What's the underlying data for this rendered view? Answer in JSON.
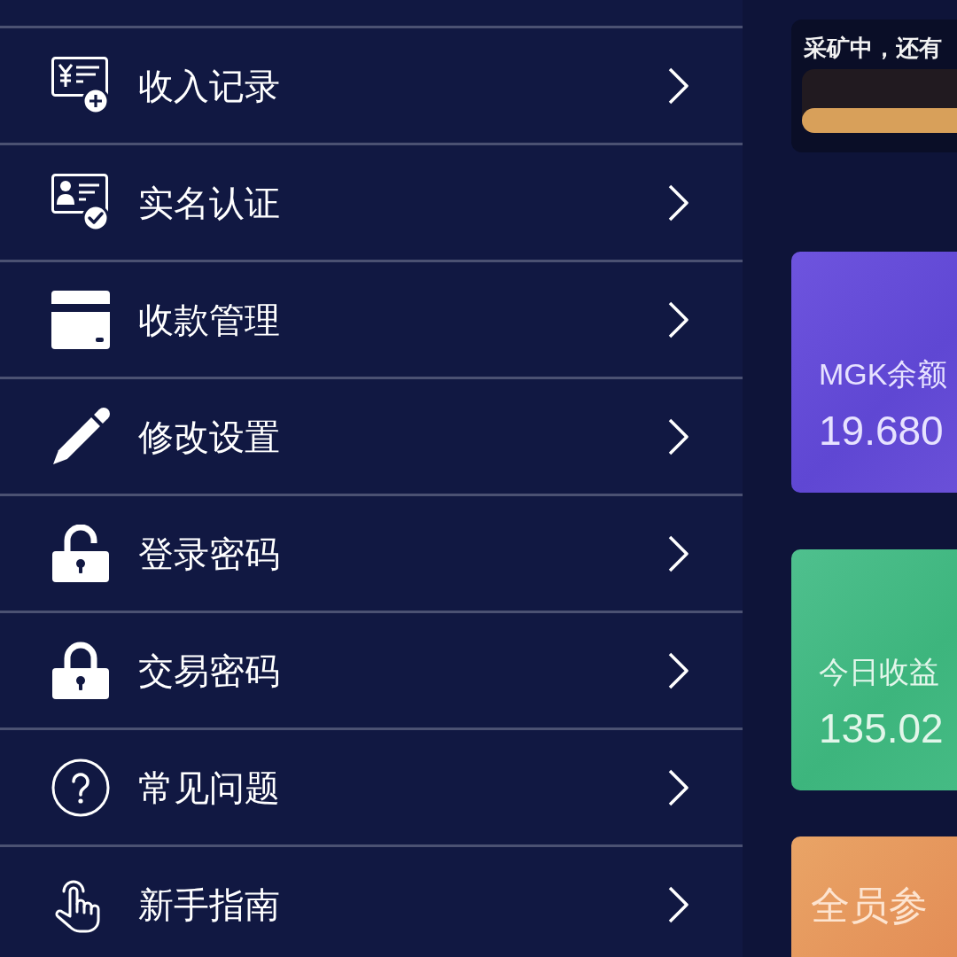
{
  "menu": {
    "items": [
      {
        "kind": "income",
        "label": "收入记录"
      },
      {
        "kind": "verify",
        "label": "实名认证"
      },
      {
        "kind": "card",
        "label": "收款管理"
      },
      {
        "kind": "edit",
        "label": "修改设置"
      },
      {
        "kind": "unlock",
        "label": "登录密码"
      },
      {
        "kind": "lock",
        "label": "交易密码"
      },
      {
        "kind": "help",
        "label": "常见问题"
      },
      {
        "kind": "guide",
        "label": "新手指南"
      }
    ]
  },
  "mining": {
    "status": "采矿中，还有",
    "progress": {
      "level": 1
    }
  },
  "stats": [
    {
      "kind": "balance",
      "label": "MGK余额",
      "value": "19.680"
    },
    {
      "kind": "earnings",
      "label": "今日收益",
      "value": "135.02"
    }
  ],
  "promo": {
    "text": "全员参"
  }
}
